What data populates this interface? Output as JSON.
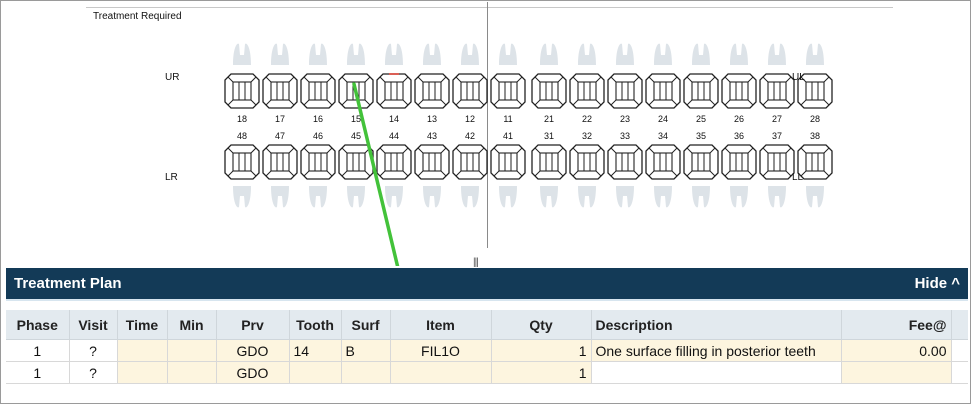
{
  "chart": {
    "title": "Treatment Required",
    "quadrants": {
      "ur": "UR",
      "ul": "UL",
      "lr": "LR",
      "ll": "LL"
    },
    "upper_numbers": [
      "18",
      "17",
      "16",
      "15",
      "14",
      "13",
      "12",
      "11",
      "21",
      "22",
      "23",
      "24",
      "25",
      "26",
      "27",
      "28"
    ],
    "lower_numbers": [
      "48",
      "47",
      "46",
      "45",
      "44",
      "43",
      "42",
      "41",
      "31",
      "32",
      "33",
      "34",
      "35",
      "36",
      "37",
      "38"
    ],
    "splitter_glyph": "|||",
    "annotation_color": "#43c23a",
    "marked_tooth": "14"
  },
  "plan": {
    "title": "Treatment Plan",
    "hide_label": "Hide ^",
    "columns": [
      "Phase",
      "Visit",
      "Time",
      "Min",
      "Prv",
      "Tooth",
      "Surf",
      "Item",
      "Qty",
      "Description",
      "Fee@"
    ],
    "rows": [
      [
        "1",
        "?",
        "",
        "",
        "GDO",
        "14",
        "B",
        "FIL1O",
        "1",
        "One surface filling in posterior teeth",
        "0.00"
      ],
      [
        "1",
        "?",
        "",
        "",
        "GDO",
        "",
        "",
        "",
        "1",
        "",
        ""
      ]
    ]
  }
}
